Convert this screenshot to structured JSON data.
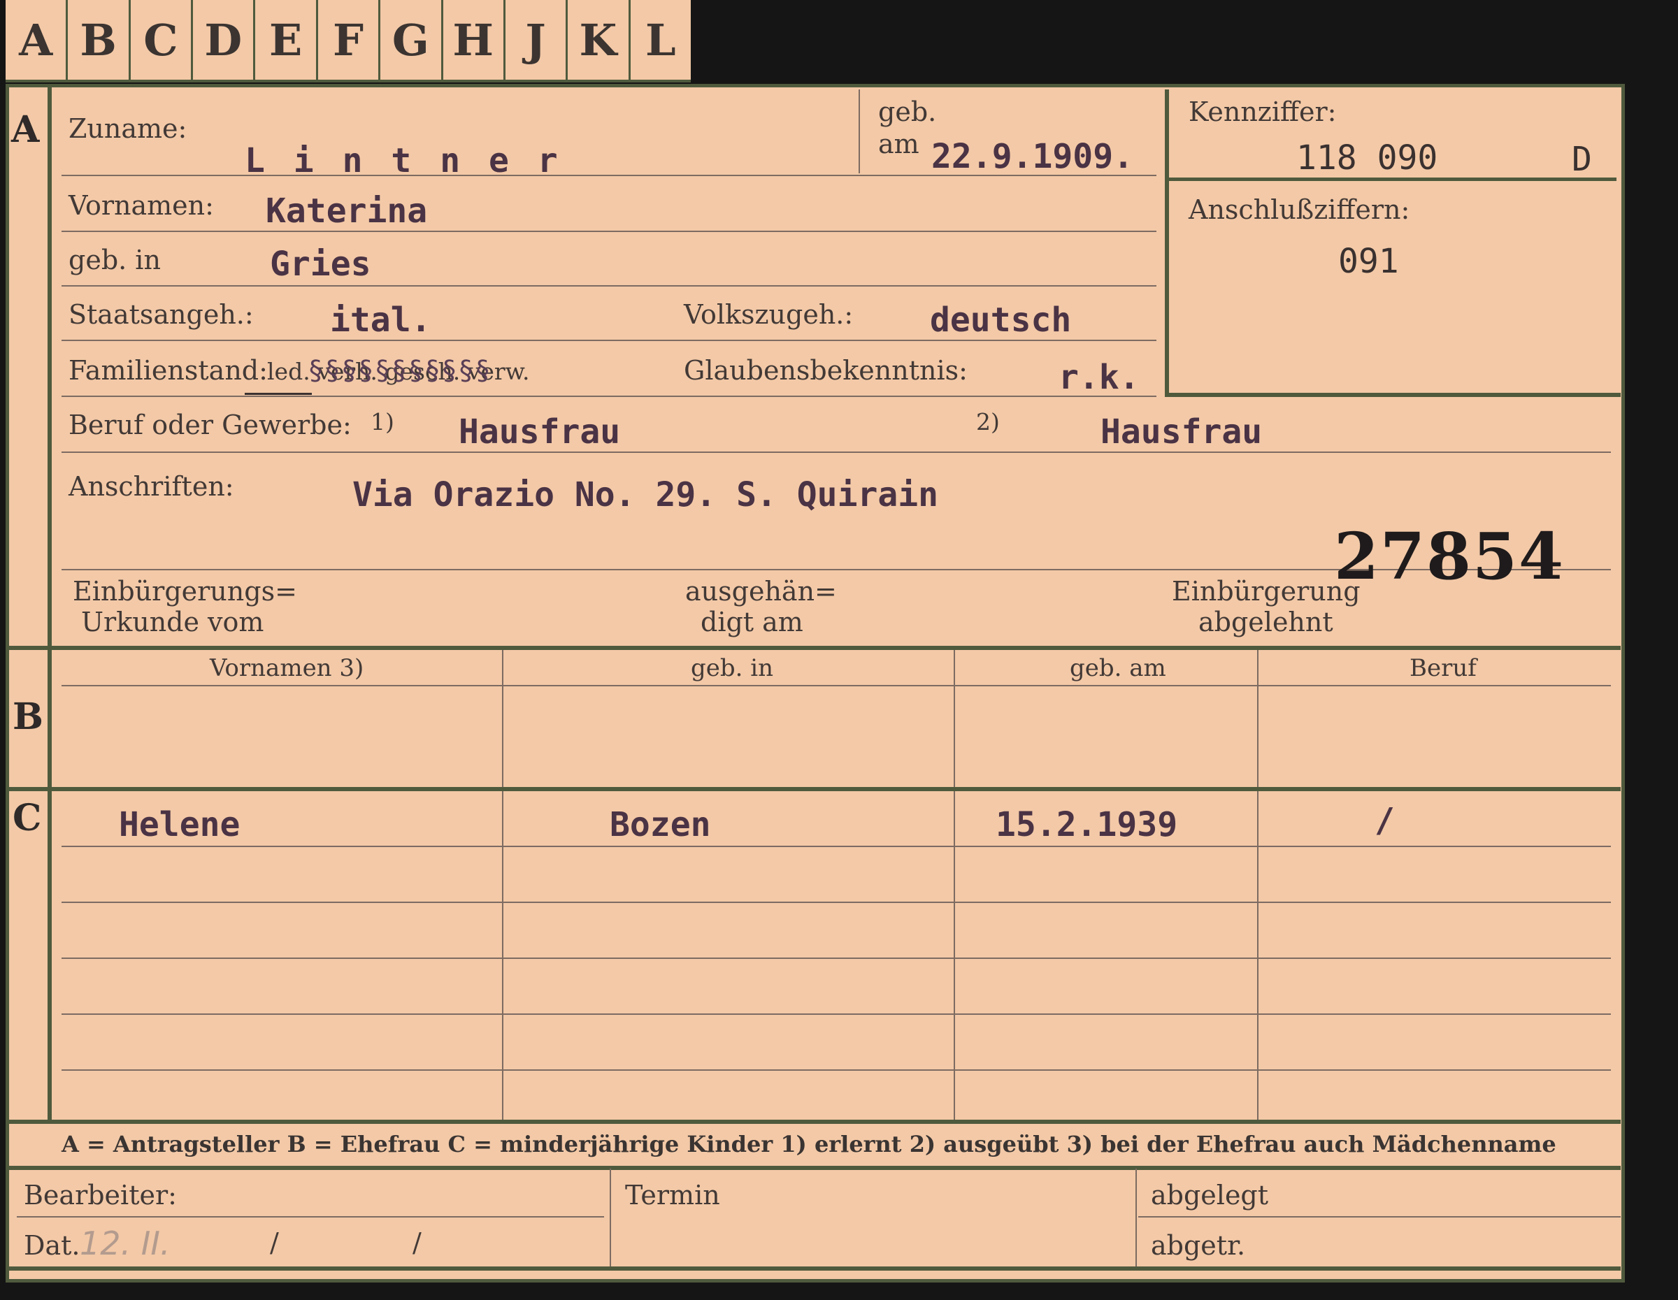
{
  "tabs": [
    "A",
    "B",
    "C",
    "D",
    "E",
    "F",
    "G",
    "H",
    "J",
    "K",
    "L"
  ],
  "section_letters": {
    "a": "A",
    "b": "B",
    "c": "C"
  },
  "labels": {
    "zuname": "Zuname:",
    "geb_am_1": "geb.",
    "geb_am_2": "am",
    "kennziffer": "Kennziffer:",
    "vornamen": "Vornamen:",
    "anschlussziffern": "Anschlußziffern:",
    "geb_in": "geb. in",
    "staatsangeh": "Staatsangeh.:",
    "volkszugeh": "Volkszugeh.:",
    "familienstand": "Familienstand:",
    "familienstand_options": "led. verh. gesch. verw.",
    "glaubensbekenntnis": "Glaubensbekenntnis:",
    "beruf_oder_gewerbe": "Beruf oder Gewerbe:",
    "fn1": "1)",
    "fn2": "2)",
    "anschriften": "Anschriften:",
    "einbuergerungs_1": "Einbürgerungs=",
    "einbuergerungs_2": "Urkunde vom",
    "ausgehaen_1": "ausgehän=",
    "ausgehaen_2": "digt am",
    "einb_abgelehnt_1": "Einbürgerung",
    "einb_abgelehnt_2": "abgelehnt",
    "col_vornamen": "Vornamen 3)",
    "col_geb_in": "geb. in",
    "col_geb_am": "geb. am",
    "col_beruf": "Beruf",
    "bearbeiter": "Bearbeiter:",
    "termin": "Termin",
    "abgelegt": "abgelegt",
    "dat": "Dat.",
    "abgetr": "abgetr."
  },
  "legend": "A = Antragsteller   B = Ehefrau   C = minderjährige Kinder   1) erlernt   2) ausgeübt   3) bei der Ehefrau auch Mädchenname",
  "values": {
    "zuname": "L i n t n e r",
    "geb_am": "22.9.1909.",
    "kennziffer": "118 090",
    "kennziffer_suffix": "D",
    "vornamen": "Katerina",
    "anschlussziffer": "091",
    "geb_in": "Gries",
    "staatsangeh": "ital.",
    "volkszugeh": "deutsch",
    "glaubensbekenntnis": "r.k.",
    "beruf_erlernt": "Hausfrau",
    "beruf_ausgeuebt": "Hausfrau",
    "anschrift": "Via Orazio No. 29. S. Quirain",
    "stamp_number": "27854",
    "dat_pencil": "12. II.",
    "dat_slash1": "/",
    "dat_slash2": "/"
  },
  "children": [
    {
      "vorname": "Helene",
      "geb_in": "Bozen",
      "geb_am": "15.2.1939",
      "beruf": "/"
    }
  ]
}
